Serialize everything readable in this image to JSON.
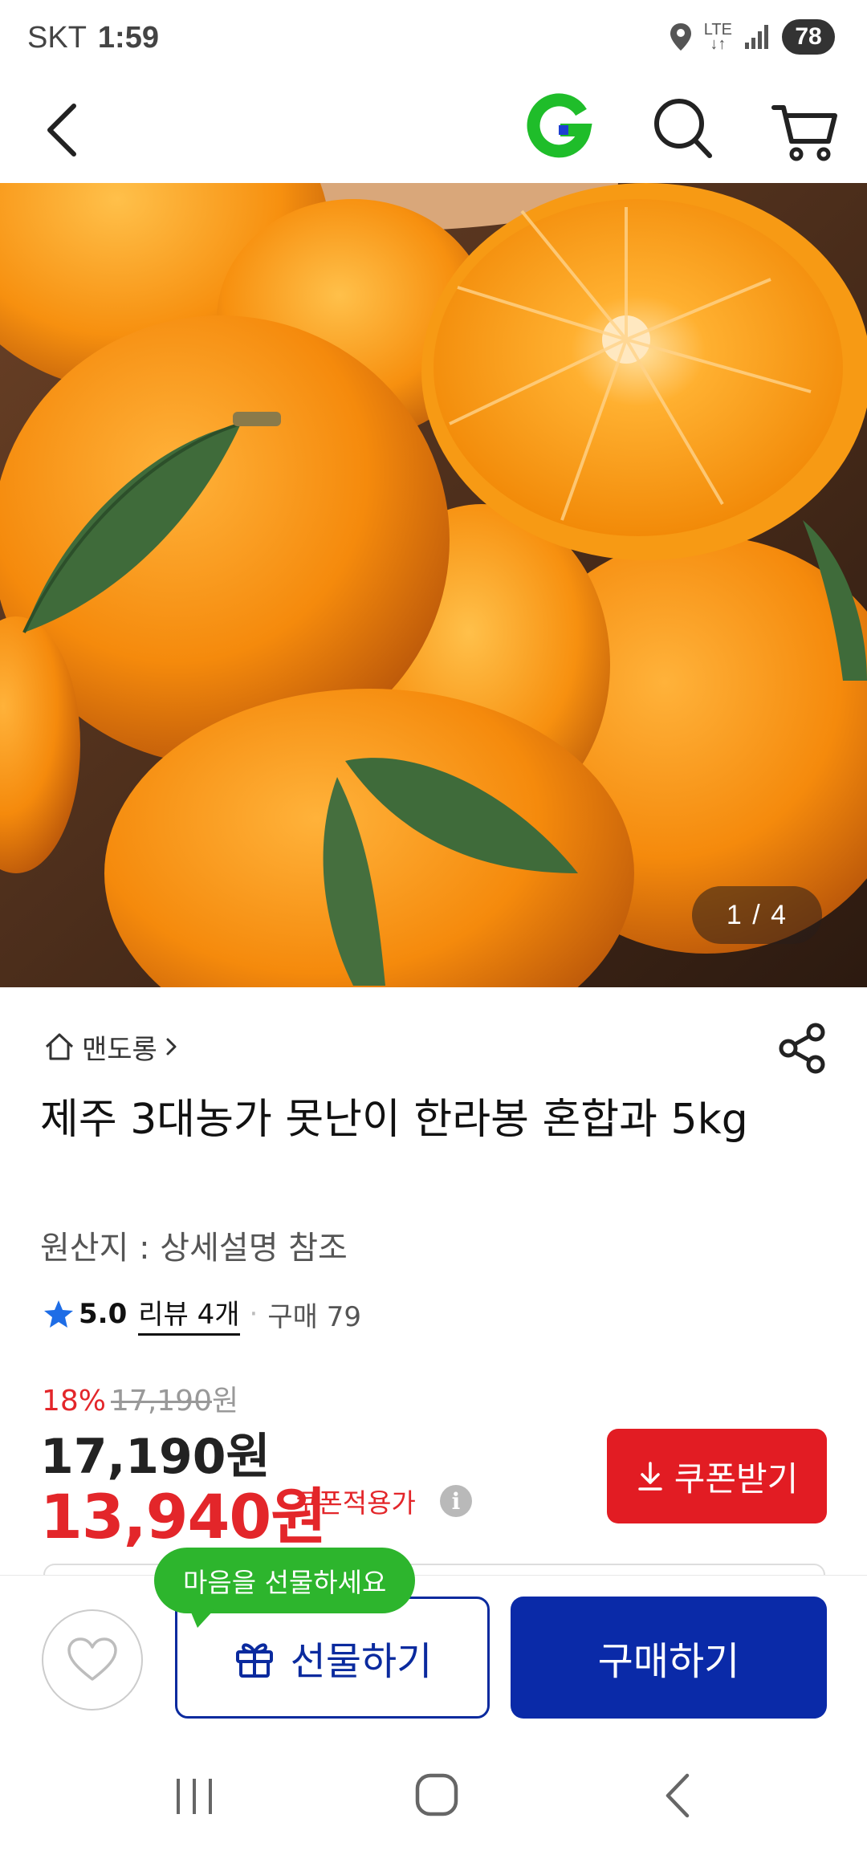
{
  "status_bar": {
    "carrier": "SKT",
    "time": "1:59",
    "network_top": "LTE",
    "network_bottom": "↓↑",
    "battery": "78"
  },
  "header": {
    "logo_letter": "G"
  },
  "gallery": {
    "counter": "1 / 4"
  },
  "product": {
    "store_name": "맨도롱",
    "title": "제주 3대농가 못난이 한라봉 혼합과 5kg",
    "origin": "원산지 : 상세설명 참조",
    "rating": "5.0",
    "reviews": "리뷰 4개",
    "separator": "·",
    "purchases": "구매 79"
  },
  "price": {
    "discount_rate": "18%",
    "original_price": "17,190",
    "original_unit": "원",
    "sale_price": "17,190원",
    "coupon_price": "13,940원",
    "coupon_price_label": "쿠폰적용가",
    "info_icon": "i",
    "coupon_button": "쿠폰받기"
  },
  "actions": {
    "gift_tooltip": "마음을 선물하세요",
    "gift_button": "선물하기",
    "buy_button": "구매하기"
  },
  "colors": {
    "accent_red": "#e21c23",
    "brand_blue": "#0a2aa8",
    "logo_green": "#1fbd2a",
    "tooltip_green": "#2db52d",
    "star_blue": "#1e6de6"
  }
}
